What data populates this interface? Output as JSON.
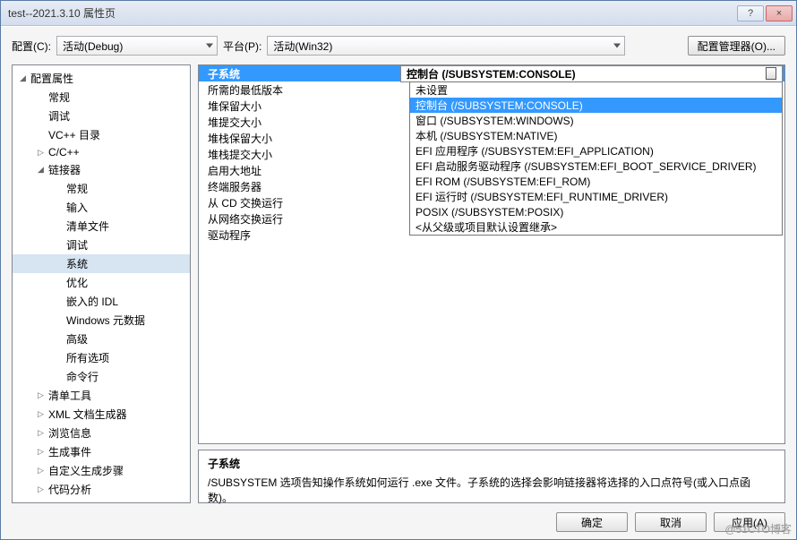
{
  "window": {
    "title": "test--2021.3.10 属性页",
    "minimize": "?",
    "close": "×"
  },
  "toolbar": {
    "config_label": "配置(C):",
    "config_value": "活动(Debug)",
    "platform_label": "平台(P):",
    "platform_value": "活动(Win32)",
    "manager_label": "配置管理器(O)..."
  },
  "tree": {
    "items": [
      {
        "level": 0,
        "arrow": "◢",
        "label": "配置属性"
      },
      {
        "level": 1,
        "arrow": "",
        "label": "常规"
      },
      {
        "level": 1,
        "arrow": "",
        "label": "调试"
      },
      {
        "level": 1,
        "arrow": "",
        "label": "VC++ 目录"
      },
      {
        "level": 1,
        "arrow": "▷",
        "label": "C/C++"
      },
      {
        "level": 1,
        "arrow": "◢",
        "label": "链接器"
      },
      {
        "level": 2,
        "arrow": "",
        "label": "常规"
      },
      {
        "level": 2,
        "arrow": "",
        "label": "输入"
      },
      {
        "level": 2,
        "arrow": "",
        "label": "清单文件"
      },
      {
        "level": 2,
        "arrow": "",
        "label": "调试"
      },
      {
        "level": 2,
        "arrow": "",
        "label": "系统",
        "selected": true
      },
      {
        "level": 2,
        "arrow": "",
        "label": "优化"
      },
      {
        "level": 2,
        "arrow": "",
        "label": "嵌入的 IDL"
      },
      {
        "level": 2,
        "arrow": "",
        "label": "Windows 元数据"
      },
      {
        "level": 2,
        "arrow": "",
        "label": "高级"
      },
      {
        "level": 2,
        "arrow": "",
        "label": "所有选项"
      },
      {
        "level": 2,
        "arrow": "",
        "label": "命令行"
      },
      {
        "level": 1,
        "arrow": "▷",
        "label": "清单工具"
      },
      {
        "level": 1,
        "arrow": "▷",
        "label": "XML 文档生成器"
      },
      {
        "level": 1,
        "arrow": "▷",
        "label": "浏览信息"
      },
      {
        "level": 1,
        "arrow": "▷",
        "label": "生成事件"
      },
      {
        "level": 1,
        "arrow": "▷",
        "label": "自定义生成步骤"
      },
      {
        "level": 1,
        "arrow": "▷",
        "label": "代码分析"
      }
    ]
  },
  "grid": {
    "header_label": "子系统",
    "header_value": "控制台 (/SUBSYSTEM:CONSOLE)",
    "rows": [
      {
        "label": "所需的最低版本",
        "value": ""
      },
      {
        "label": "堆保留大小",
        "value": ""
      },
      {
        "label": "堆提交大小",
        "value": ""
      },
      {
        "label": "堆栈保留大小",
        "value": ""
      },
      {
        "label": "堆栈提交大小",
        "value": ""
      },
      {
        "label": "启用大地址",
        "value": ""
      },
      {
        "label": "终端服务器",
        "value": ""
      },
      {
        "label": "从 CD 交换运行",
        "value": ""
      },
      {
        "label": "从网络交换运行",
        "value": ""
      },
      {
        "label": "驱动程序",
        "value": ""
      }
    ]
  },
  "dropdown": {
    "items": [
      {
        "label": "未设置"
      },
      {
        "label": "控制台 (/SUBSYSTEM:CONSOLE)",
        "selected": true
      },
      {
        "label": "窗口 (/SUBSYSTEM:WINDOWS)"
      },
      {
        "label": "本机 (/SUBSYSTEM:NATIVE)"
      },
      {
        "label": "EFI 应用程序 (/SUBSYSTEM:EFI_APPLICATION)"
      },
      {
        "label": "EFI 启动服务驱动程序 (/SUBSYSTEM:EFI_BOOT_SERVICE_DRIVER)"
      },
      {
        "label": "EFI ROM (/SUBSYSTEM:EFI_ROM)"
      },
      {
        "label": "EFI 运行时 (/SUBSYSTEM:EFI_RUNTIME_DRIVER)"
      },
      {
        "label": "POSIX (/SUBSYSTEM:POSIX)"
      },
      {
        "label": "<从父级或项目默认设置继承>"
      }
    ]
  },
  "help": {
    "title": "子系统",
    "text": "/SUBSYSTEM 选项告知操作系统如何运行 .exe 文件。子系统的选择会影响链接器将选择的入口点符号(或入口点函数)。"
  },
  "footer": {
    "ok": "确定",
    "cancel": "取消",
    "apply": "应用(A)"
  },
  "watermark": "@51CTO博客"
}
